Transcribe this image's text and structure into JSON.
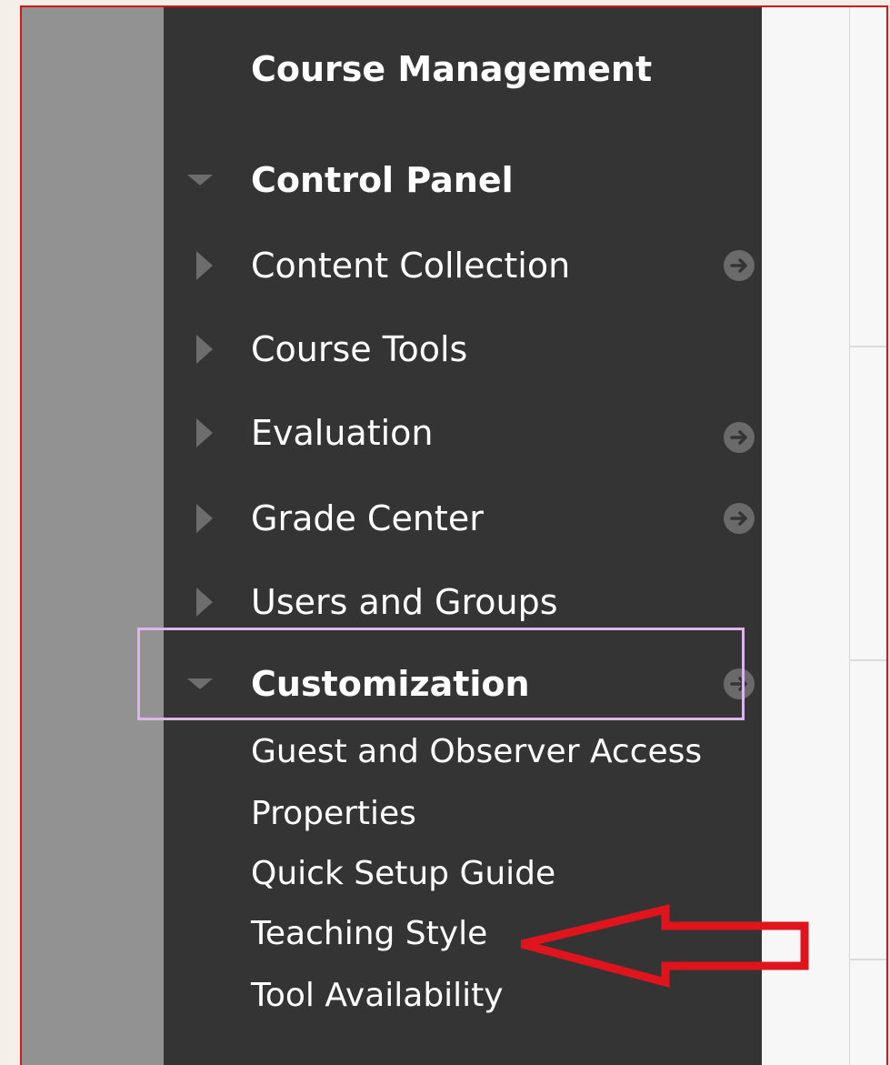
{
  "panel": {
    "heading": "Course Management",
    "control_panel_label": "Control Panel",
    "items": [
      {
        "label": "Content Collection",
        "has_arrow": true
      },
      {
        "label": "Course Tools",
        "has_arrow": false
      },
      {
        "label": "Evaluation",
        "has_arrow": true
      },
      {
        "label": "Grade Center",
        "has_arrow": true
      },
      {
        "label": "Users and Groups",
        "has_arrow": false
      }
    ],
    "customization": {
      "label": "Customization",
      "expanded": true,
      "subitems": [
        "Guest and Observer Access",
        "Properties",
        "Quick Setup Guide",
        "Teaching Style",
        "Tool Availability"
      ]
    }
  },
  "annotation": {
    "highlighted_item": "Customization",
    "arrow_target": "Teaching Style",
    "arrow_color": "#e0141c",
    "highlight_color": "#dcb6ea"
  },
  "colors": {
    "panel_bg": "#343434",
    "left_strip": "#929292",
    "frame_border": "#d01818"
  }
}
